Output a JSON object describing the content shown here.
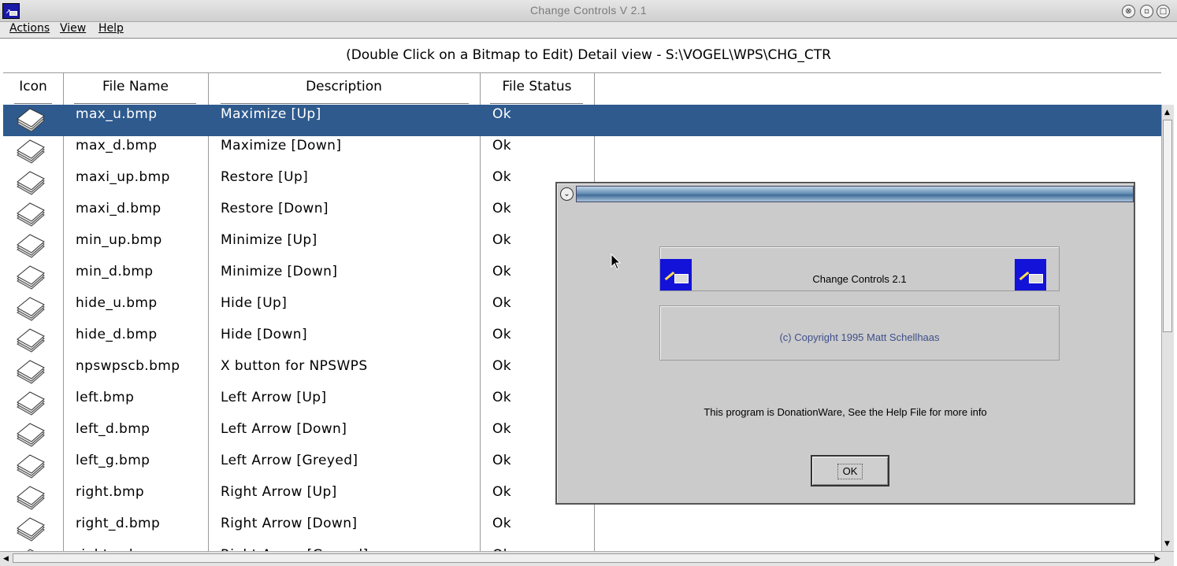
{
  "window": {
    "title": "Change Controls V 2.1",
    "controls": [
      "⊗",
      "▫",
      "□"
    ]
  },
  "menu": {
    "items": [
      "Actions",
      "View",
      "Help"
    ]
  },
  "heading": "(Double Click on a Bitmap to Edit) Detail view - S:\\VOGEL\\WPS\\CHG_CTR",
  "table": {
    "columns": [
      "Icon",
      "File Name",
      "Description",
      "File Status"
    ],
    "selected_index": 0,
    "rows": [
      {
        "file": "max_u.bmp",
        "description": "Maximize [Up]",
        "status": "Ok"
      },
      {
        "file": "max_d.bmp",
        "description": "Maximize [Down]",
        "status": "Ok"
      },
      {
        "file": "maxi_up.bmp",
        "description": "Restore [Up]",
        "status": "Ok"
      },
      {
        "file": "maxi_d.bmp",
        "description": "Restore [Down]",
        "status": "Ok"
      },
      {
        "file": "min_up.bmp",
        "description": "Minimize [Up]",
        "status": "Ok"
      },
      {
        "file": "min_d.bmp",
        "description": "Minimize [Down]",
        "status": "Ok"
      },
      {
        "file": "hide_u.bmp",
        "description": "Hide [Up]",
        "status": "Ok"
      },
      {
        "file": "hide_d.bmp",
        "description": "Hide [Down]",
        "status": "Ok"
      },
      {
        "file": "npswpscb.bmp",
        "description": "X button for NPSWPS",
        "status": "Ok"
      },
      {
        "file": "left.bmp",
        "description": "Left Arrow [Up]",
        "status": "Ok"
      },
      {
        "file": "left_d.bmp",
        "description": "Left Arrow [Down]",
        "status": "Ok"
      },
      {
        "file": "left_g.bmp",
        "description": "Left Arrow [Greyed]",
        "status": "Ok"
      },
      {
        "file": "right.bmp",
        "description": "Right Arrow [Up]",
        "status": "Ok"
      },
      {
        "file": "right_d.bmp",
        "description": "Right Arrow [Down]",
        "status": "Ok"
      },
      {
        "file": "right_g.bmp",
        "description": "Right Arrow [Greyed]",
        "status": "Ok"
      }
    ],
    "icon": "bitmap-stack-icon"
  },
  "dialog": {
    "system_menu": "⌄",
    "product": "Change Controls 2.1",
    "copyright": "(c) Copyright 1995 Matt Schellhaas",
    "notice": "This program is DonationWare, See the Help File for more info",
    "ok_label": "OK",
    "copyright_color": "#3f4f8a"
  },
  "colors": {
    "selection": "#2e5a8e",
    "dialog_bg": "#cbcbcb",
    "icon_blue": "#1212d8"
  }
}
